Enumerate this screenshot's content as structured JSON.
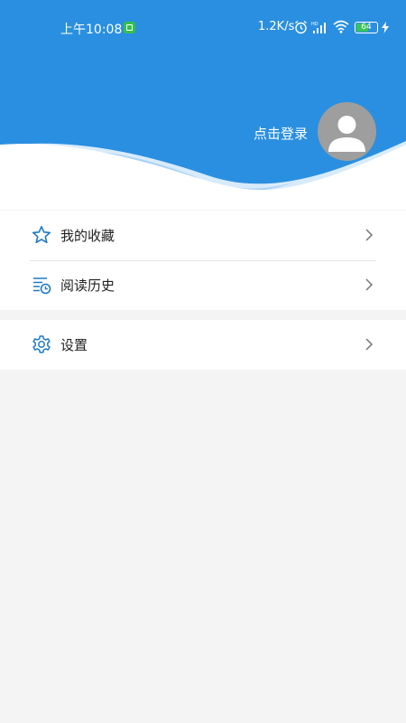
{
  "status_bar": {
    "time": "上午10:08",
    "network_speed": "1.2K/s",
    "battery_level": "64",
    "battery_percent": 64,
    "icons": [
      "notification-icon",
      "alarm-icon",
      "hd-signal-icon",
      "wifi-icon",
      "battery-icon",
      "charging-icon"
    ]
  },
  "profile": {
    "login_label": "点击登录",
    "avatar_icon": "user-avatar-icon"
  },
  "menu": {
    "favorites": {
      "label": "我的收藏",
      "icon": "star-icon"
    },
    "history": {
      "label": "阅读历史",
      "icon": "history-list-icon"
    },
    "settings": {
      "label": "设置",
      "icon": "gear-icon"
    }
  },
  "colors": {
    "header_blue": "#2a8fe0",
    "icon_blue": "#1f7ac4",
    "wave_light": "#a9d2f5",
    "background": "#f4f4f4",
    "avatar_gray": "#9e9e9e"
  }
}
